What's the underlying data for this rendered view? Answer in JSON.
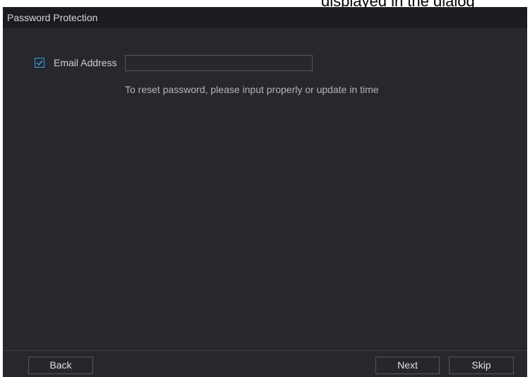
{
  "top_overflow_text": "displayed in the dialog",
  "dialog": {
    "title": "Password Protection",
    "email": {
      "checked": true,
      "label": "Email Address",
      "value": ""
    },
    "hint": "To reset password, please input properly or update in time"
  },
  "footer": {
    "back_label": "Back",
    "next_label": "Next",
    "skip_label": "Skip"
  },
  "colors": {
    "background": "#27282d",
    "title_bar": "#1b1c20",
    "accent": "#39a0e0",
    "text": "#cfcfcf",
    "border": "#55575d"
  },
  "icons": {
    "checkbox": "check-icon"
  }
}
